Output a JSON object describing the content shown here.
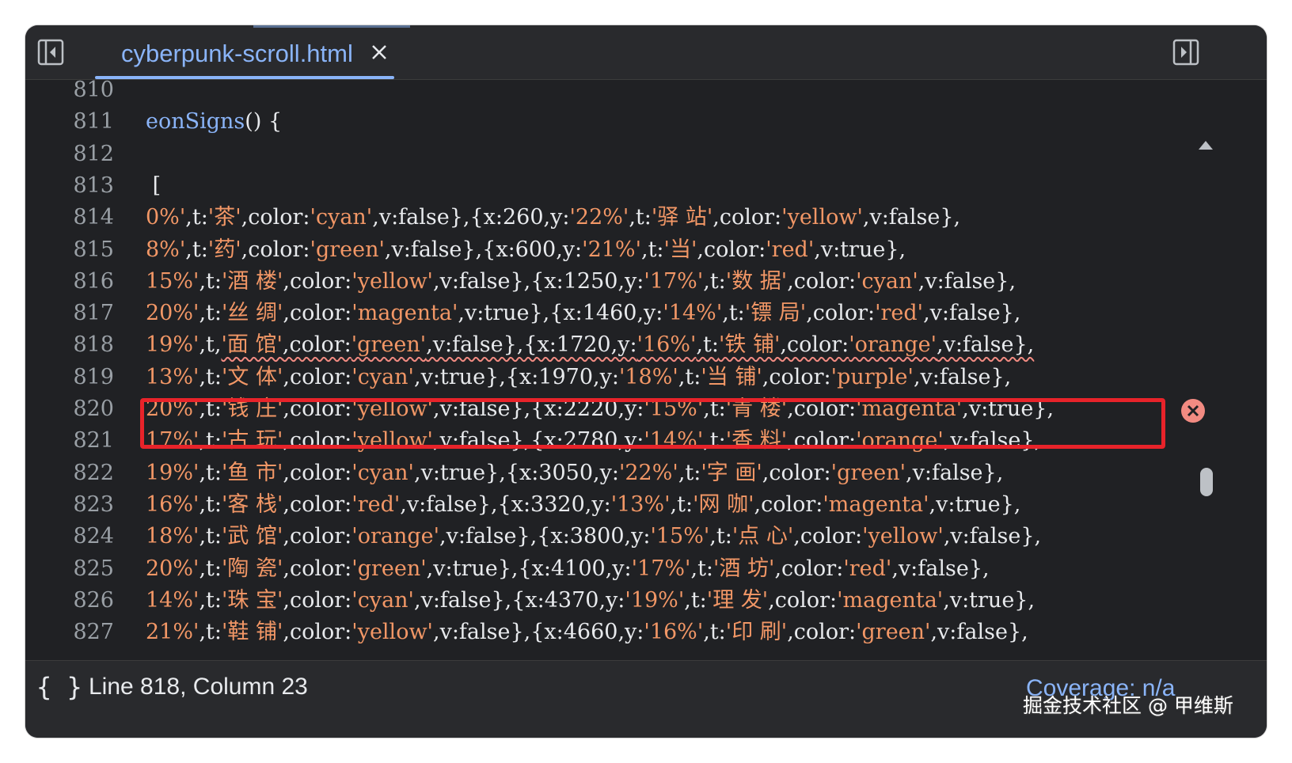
{
  "tab": {
    "title": "cyberpunk-scroll.html"
  },
  "icons": {
    "left_panel": "sidebar-toggle-left-icon",
    "right_panel": "sidebar-toggle-right-icon",
    "close": "close-icon",
    "error": "error-icon",
    "braces": "pretty-print-icon"
  },
  "code_lines": [
    {
      "n": "810",
      "segs": []
    },
    {
      "n": "811",
      "segs": [
        {
          "c": "fn",
          "t": "eonSigns"
        },
        {
          "c": "p",
          "t": "() {"
        }
      ]
    },
    {
      "n": "812",
      "segs": []
    },
    {
      "n": "813",
      "segs": [
        {
          "c": "p",
          "t": " ["
        }
      ]
    },
    {
      "n": "814",
      "segs": [
        {
          "c": "s",
          "t": "0%'"
        },
        {
          "c": "p",
          "t": ",t:"
        },
        {
          "c": "s",
          "t": "'茶'"
        },
        {
          "c": "p",
          "t": ",color:"
        },
        {
          "c": "s",
          "t": "'cyan'"
        },
        {
          "c": "p",
          "t": ",v:false},{x:260,y:"
        },
        {
          "c": "s",
          "t": "'22%'"
        },
        {
          "c": "p",
          "t": ",t:"
        },
        {
          "c": "s",
          "t": "'驿 站'"
        },
        {
          "c": "p",
          "t": ",color:"
        },
        {
          "c": "s",
          "t": "'yellow'"
        },
        {
          "c": "p",
          "t": ",v:false},"
        }
      ]
    },
    {
      "n": "815",
      "segs": [
        {
          "c": "s",
          "t": "8%'"
        },
        {
          "c": "p",
          "t": ",t:"
        },
        {
          "c": "s",
          "t": "'药'"
        },
        {
          "c": "p",
          "t": ",color:"
        },
        {
          "c": "s",
          "t": "'green'"
        },
        {
          "c": "p",
          "t": ",v:false},{x:600,y:"
        },
        {
          "c": "s",
          "t": "'21%'"
        },
        {
          "c": "p",
          "t": ",t:"
        },
        {
          "c": "s",
          "t": "'当'"
        },
        {
          "c": "p",
          "t": ",color:"
        },
        {
          "c": "s",
          "t": "'red'"
        },
        {
          "c": "p",
          "t": ",v:true},"
        }
      ]
    },
    {
      "n": "816",
      "segs": [
        {
          "c": "s",
          "t": "15%'"
        },
        {
          "c": "p",
          "t": ",t:"
        },
        {
          "c": "s",
          "t": "'酒 楼'"
        },
        {
          "c": "p",
          "t": ",color:"
        },
        {
          "c": "s",
          "t": "'yellow'"
        },
        {
          "c": "p",
          "t": ",v:false},{x:1250,y:"
        },
        {
          "c": "s",
          "t": "'17%'"
        },
        {
          "c": "p",
          "t": ",t:"
        },
        {
          "c": "s",
          "t": "'数 据'"
        },
        {
          "c": "p",
          "t": ",color:"
        },
        {
          "c": "s",
          "t": "'cyan'"
        },
        {
          "c": "p",
          "t": ",v:false},"
        }
      ]
    },
    {
      "n": "817",
      "segs": [
        {
          "c": "s",
          "t": "20%'"
        },
        {
          "c": "p",
          "t": ",t:"
        },
        {
          "c": "s",
          "t": "'丝 绸'"
        },
        {
          "c": "p",
          "t": ",color:"
        },
        {
          "c": "s",
          "t": "'magenta'"
        },
        {
          "c": "p",
          "t": ",v:true},{x:1460,y:"
        },
        {
          "c": "s",
          "t": "'14%'"
        },
        {
          "c": "p",
          "t": ",t:"
        },
        {
          "c": "s",
          "t": "'镖 局'"
        },
        {
          "c": "p",
          "t": ",color:"
        },
        {
          "c": "s",
          "t": "'red'"
        },
        {
          "c": "p",
          "t": ",v:false},"
        }
      ]
    },
    {
      "n": "818",
      "error": true,
      "segs": [
        {
          "c": "s",
          "t": "19%'"
        },
        {
          "c": "p",
          "t": ",t,"
        },
        {
          "c": "s",
          "t": "'面 馆'"
        },
        {
          "c": "p",
          "t": ",color:"
        },
        {
          "c": "s",
          "t": "'green'"
        },
        {
          "c": "p",
          "t": ",v:false},{x:1720,y:"
        },
        {
          "c": "s",
          "t": "'16%'"
        },
        {
          "c": "p",
          "t": ",t:"
        },
        {
          "c": "s",
          "t": "'铁 铺'"
        },
        {
          "c": "p",
          "t": ",color:"
        },
        {
          "c": "s",
          "t": "'orange'"
        },
        {
          "c": "p",
          "t": ",v:false},"
        }
      ]
    },
    {
      "n": "819",
      "segs": [
        {
          "c": "s",
          "t": "13%'"
        },
        {
          "c": "p",
          "t": ",t:"
        },
        {
          "c": "s",
          "t": "'文 体'"
        },
        {
          "c": "p",
          "t": ",color:"
        },
        {
          "c": "s",
          "t": "'cyan'"
        },
        {
          "c": "p",
          "t": ",v:true},{x:1970,y:"
        },
        {
          "c": "s",
          "t": "'18%'"
        },
        {
          "c": "p",
          "t": ",t:"
        },
        {
          "c": "s",
          "t": "'当 铺'"
        },
        {
          "c": "p",
          "t": ",color:"
        },
        {
          "c": "s",
          "t": "'purple'"
        },
        {
          "c": "p",
          "t": ",v:false},"
        }
      ]
    },
    {
      "n": "820",
      "segs": [
        {
          "c": "s",
          "t": "20%'"
        },
        {
          "c": "p",
          "t": ",t:"
        },
        {
          "c": "s",
          "t": "'钱 庄'"
        },
        {
          "c": "p",
          "t": ",color:"
        },
        {
          "c": "s",
          "t": "'yellow'"
        },
        {
          "c": "p",
          "t": ",v:false},{x:2220,y:"
        },
        {
          "c": "s",
          "t": "'15%'"
        },
        {
          "c": "p",
          "t": ",t:"
        },
        {
          "c": "s",
          "t": "'青 楼'"
        },
        {
          "c": "p",
          "t": ",color:"
        },
        {
          "c": "s",
          "t": "'magenta'"
        },
        {
          "c": "p",
          "t": ",v:true},"
        }
      ]
    },
    {
      "n": "821",
      "segs": [
        {
          "c": "s",
          "t": "17%'"
        },
        {
          "c": "p",
          "t": ",t:"
        },
        {
          "c": "s",
          "t": "'古 玩'"
        },
        {
          "c": "p",
          "t": ",color:"
        },
        {
          "c": "s",
          "t": "'yellow'"
        },
        {
          "c": "p",
          "t": ",v:false},{x:2780,y:"
        },
        {
          "c": "s",
          "t": "'14%'"
        },
        {
          "c": "p",
          "t": ",t:"
        },
        {
          "c": "s",
          "t": "'香 料'"
        },
        {
          "c": "p",
          "t": ",color:"
        },
        {
          "c": "s",
          "t": "'orange'"
        },
        {
          "c": "p",
          "t": ",v:false},"
        }
      ]
    },
    {
      "n": "822",
      "segs": [
        {
          "c": "s",
          "t": "19%'"
        },
        {
          "c": "p",
          "t": ",t:"
        },
        {
          "c": "s",
          "t": "'鱼 市'"
        },
        {
          "c": "p",
          "t": ",color:"
        },
        {
          "c": "s",
          "t": "'cyan'"
        },
        {
          "c": "p",
          "t": ",v:true},{x:3050,y:"
        },
        {
          "c": "s",
          "t": "'22%'"
        },
        {
          "c": "p",
          "t": ",t:"
        },
        {
          "c": "s",
          "t": "'字 画'"
        },
        {
          "c": "p",
          "t": ",color:"
        },
        {
          "c": "s",
          "t": "'green'"
        },
        {
          "c": "p",
          "t": ",v:false},"
        }
      ]
    },
    {
      "n": "823",
      "segs": [
        {
          "c": "s",
          "t": "16%'"
        },
        {
          "c": "p",
          "t": ",t:"
        },
        {
          "c": "s",
          "t": "'客 栈'"
        },
        {
          "c": "p",
          "t": ",color:"
        },
        {
          "c": "s",
          "t": "'red'"
        },
        {
          "c": "p",
          "t": ",v:false},{x:3320,y:"
        },
        {
          "c": "s",
          "t": "'13%'"
        },
        {
          "c": "p",
          "t": ",t:"
        },
        {
          "c": "s",
          "t": "'网 咖'"
        },
        {
          "c": "p",
          "t": ",color:"
        },
        {
          "c": "s",
          "t": "'magenta'"
        },
        {
          "c": "p",
          "t": ",v:true},"
        }
      ]
    },
    {
      "n": "824",
      "segs": [
        {
          "c": "s",
          "t": "18%'"
        },
        {
          "c": "p",
          "t": ",t:"
        },
        {
          "c": "s",
          "t": "'武 馆'"
        },
        {
          "c": "p",
          "t": ",color:"
        },
        {
          "c": "s",
          "t": "'orange'"
        },
        {
          "c": "p",
          "t": ",v:false},{x:3800,y:"
        },
        {
          "c": "s",
          "t": "'15%'"
        },
        {
          "c": "p",
          "t": ",t:"
        },
        {
          "c": "s",
          "t": "'点 心'"
        },
        {
          "c": "p",
          "t": ",color:"
        },
        {
          "c": "s",
          "t": "'yellow'"
        },
        {
          "c": "p",
          "t": ",v:false},"
        }
      ]
    },
    {
      "n": "825",
      "segs": [
        {
          "c": "s",
          "t": "20%'"
        },
        {
          "c": "p",
          "t": ",t:"
        },
        {
          "c": "s",
          "t": "'陶 瓷'"
        },
        {
          "c": "p",
          "t": ",color:"
        },
        {
          "c": "s",
          "t": "'green'"
        },
        {
          "c": "p",
          "t": ",v:true},{x:4100,y:"
        },
        {
          "c": "s",
          "t": "'17%'"
        },
        {
          "c": "p",
          "t": ",t:"
        },
        {
          "c": "s",
          "t": "'酒 坊'"
        },
        {
          "c": "p",
          "t": ",color:"
        },
        {
          "c": "s",
          "t": "'red'"
        },
        {
          "c": "p",
          "t": ",v:false},"
        }
      ]
    },
    {
      "n": "826",
      "segs": [
        {
          "c": "s",
          "t": "14%'"
        },
        {
          "c": "p",
          "t": ",t:"
        },
        {
          "c": "s",
          "t": "'珠 宝'"
        },
        {
          "c": "p",
          "t": ",color:"
        },
        {
          "c": "s",
          "t": "'cyan'"
        },
        {
          "c": "p",
          "t": ",v:false},{x:4370,y:"
        },
        {
          "c": "s",
          "t": "'19%'"
        },
        {
          "c": "p",
          "t": ",t:"
        },
        {
          "c": "s",
          "t": "'理 发'"
        },
        {
          "c": "p",
          "t": ",color:"
        },
        {
          "c": "s",
          "t": "'magenta'"
        },
        {
          "c": "p",
          "t": ",v:true},"
        }
      ]
    },
    {
      "n": "827",
      "segs": [
        {
          "c": "s",
          "t": "21%'"
        },
        {
          "c": "p",
          "t": ",t:"
        },
        {
          "c": "s",
          "t": "'鞋 铺'"
        },
        {
          "c": "p",
          "t": ",color:"
        },
        {
          "c": "s",
          "t": "'yellow'"
        },
        {
          "c": "p",
          "t": ",v:false},{x:4660,y:"
        },
        {
          "c": "s",
          "t": "'16%'"
        },
        {
          "c": "p",
          "t": ",t:"
        },
        {
          "c": "s",
          "t": "'印 刷'"
        },
        {
          "c": "p",
          "t": ",color:"
        },
        {
          "c": "s",
          "t": "'green'"
        },
        {
          "c": "p",
          "t": ",v:false},"
        }
      ]
    }
  ],
  "status": {
    "braces": "{ }",
    "position": "Line 818, Column 23",
    "coverage": "Coverage: n/a"
  },
  "watermark": "掘金技术社区 @ 甲维斯",
  "colors": {
    "accent": "#8ab4f8",
    "string": "#f29766",
    "error": "#f28b82",
    "highlight_box": "#e8232a",
    "background": "#202124"
  }
}
